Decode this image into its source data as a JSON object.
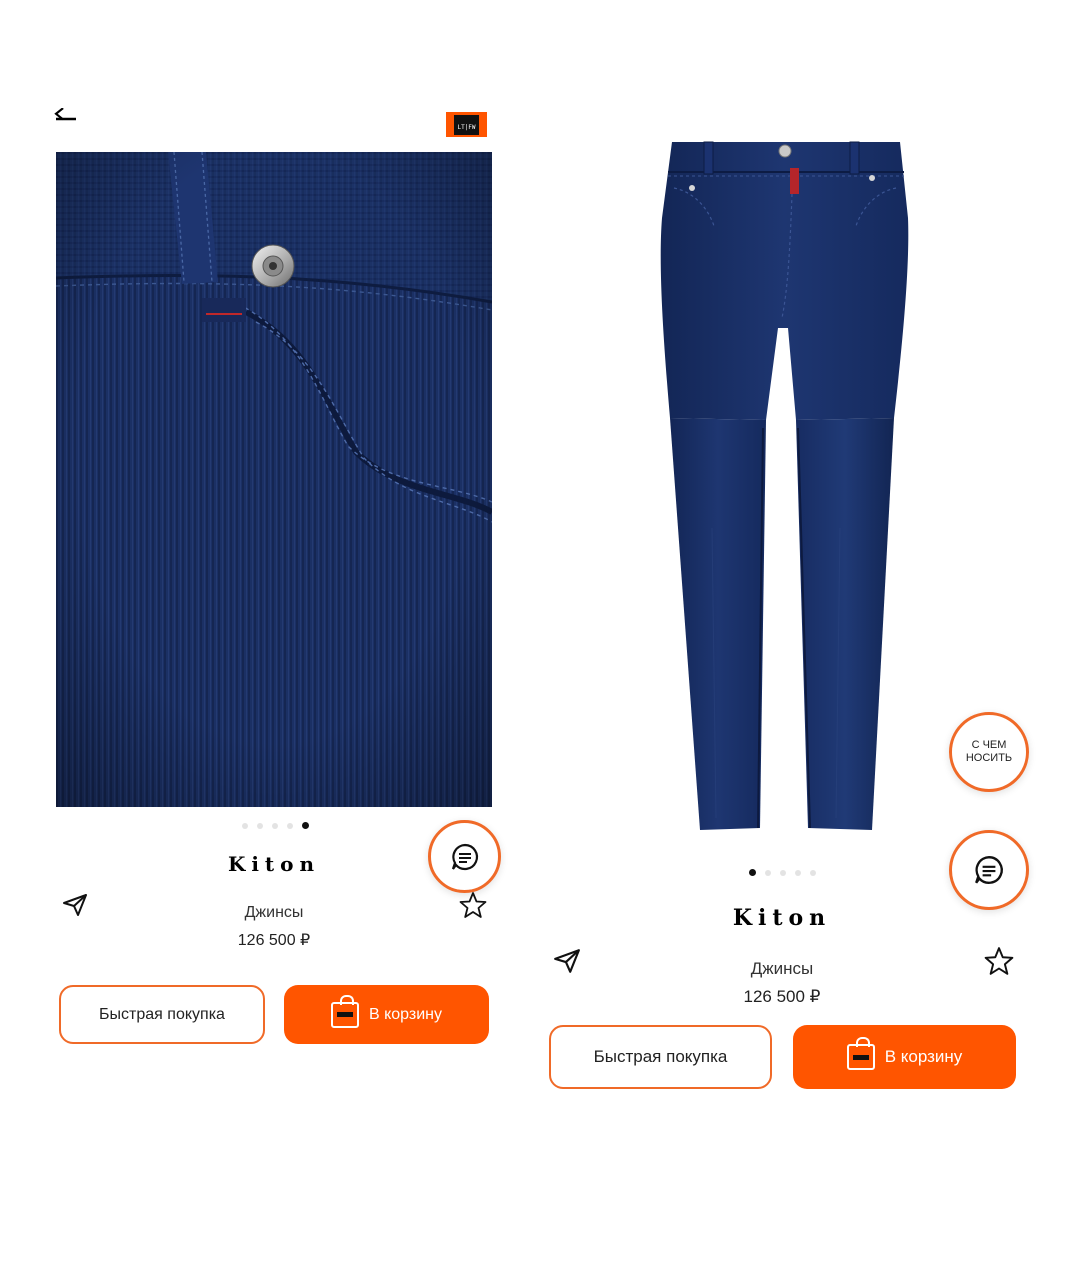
{
  "colors": {
    "accent": "#ff5500",
    "accent_border": "#f06a28",
    "denim": "#1b2f5f"
  },
  "left": {
    "back_icon": "arrow-left-icon",
    "header_badge_text": "LT|FW",
    "gallery": {
      "total": 5,
      "active_index": 5
    },
    "brand": "Kiton",
    "product_name": "Джинсы",
    "price": "126 500 ₽",
    "quick_buy_label": "Быстрая покупка",
    "add_to_cart_label": "В корзину",
    "chat_icon": "chat-icon",
    "share_icon": "send-icon",
    "favorite_icon": "star-icon"
  },
  "right": {
    "what_to_wear_label_line1": "С ЧЕМ",
    "what_to_wear_label_line2": "НОСИТЬ",
    "gallery": {
      "total": 5,
      "active_index": 1
    },
    "brand": "Kiton",
    "product_name": "Джинсы",
    "price": "126 500 ₽",
    "quick_buy_label": "Быстрая покупка",
    "add_to_cart_label": "В корзину",
    "chat_icon": "chat-icon",
    "share_icon": "send-icon",
    "favorite_icon": "star-icon"
  }
}
